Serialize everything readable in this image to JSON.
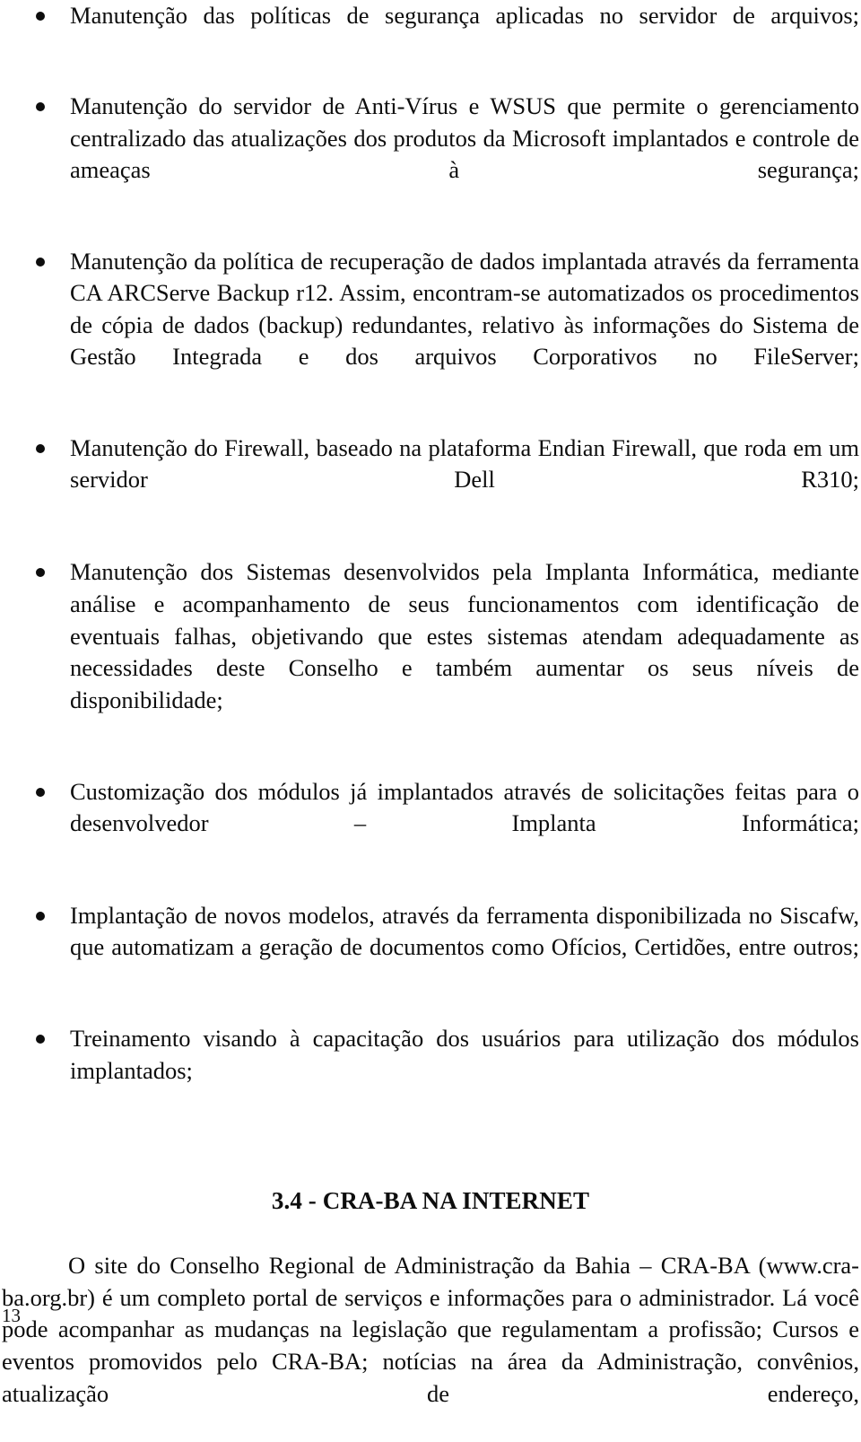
{
  "document": {
    "page_number": "13",
    "bullets": [
      {
        "id": "bullet-file-server-policies",
        "text": "Manutenção das políticas de segurança aplicadas no servidor de arquivos;"
      },
      {
        "id": "bullet-antivirus-wsus",
        "text": "Manutenção do servidor de Anti-Vírus e WSUS que permite o gerenciamento centralizado das atualizações dos produtos da Microsoft implantados e controle de ameaças à segurança;"
      },
      {
        "id": "bullet-backup-arcserve",
        "text": "Manutenção da política de recuperação de dados implantada através da ferramenta CA ARCServe Backup r12. Assim, encontram-se automatizados os procedimentos de cópia de dados (backup) redundantes, relativo às informações do Sistema de Gestão Integrada e dos arquivos Corporativos no FileServer;"
      },
      {
        "id": "bullet-firewall-endian",
        "text": "Manutenção do Firewall, baseado na plataforma Endian Firewall, que roda em um servidor Dell R310;"
      },
      {
        "id": "bullet-systems-implanta",
        "text": "Manutenção dos Sistemas desenvolvidos pela Implanta Informática, mediante análise e acompanhamento de seus funcionamentos com identificação de eventuais falhas, objetivando que estes sistemas atendam adequadamente as necessidades deste Conselho e também aumentar os seus níveis de disponibilidade;"
      },
      {
        "id": "bullet-customization-modules",
        "text": "Customização dos módulos já implantados através de solicitações feitas para o desenvolvedor – Implanta Informática;"
      },
      {
        "id": "bullet-new-models-siscafw",
        "text": "Implantação de novos modelos, através da ferramenta disponibilizada no Siscafw, que automatizam a geração de documentos como Ofícios, Certidões, entre outros;"
      },
      {
        "id": "bullet-training-users",
        "text": "Treinamento visando à capacitação dos usuários para utilização dos módulos implantados;"
      }
    ],
    "section": {
      "heading": "3.4 - CRA-BA NA INTERNET",
      "paragraph": "O site do Conselho Regional de Administração da Bahia – CRA-BA (www.cra-ba.org.br) é um completo portal de serviços e informações para o administrador. Lá você pode acompanhar as mudanças na legislação que regulamentam a profissão; Cursos e eventos promovidos pelo CRA-BA; notícias na área da Administração, convênios, atualização de endereço,"
    }
  }
}
